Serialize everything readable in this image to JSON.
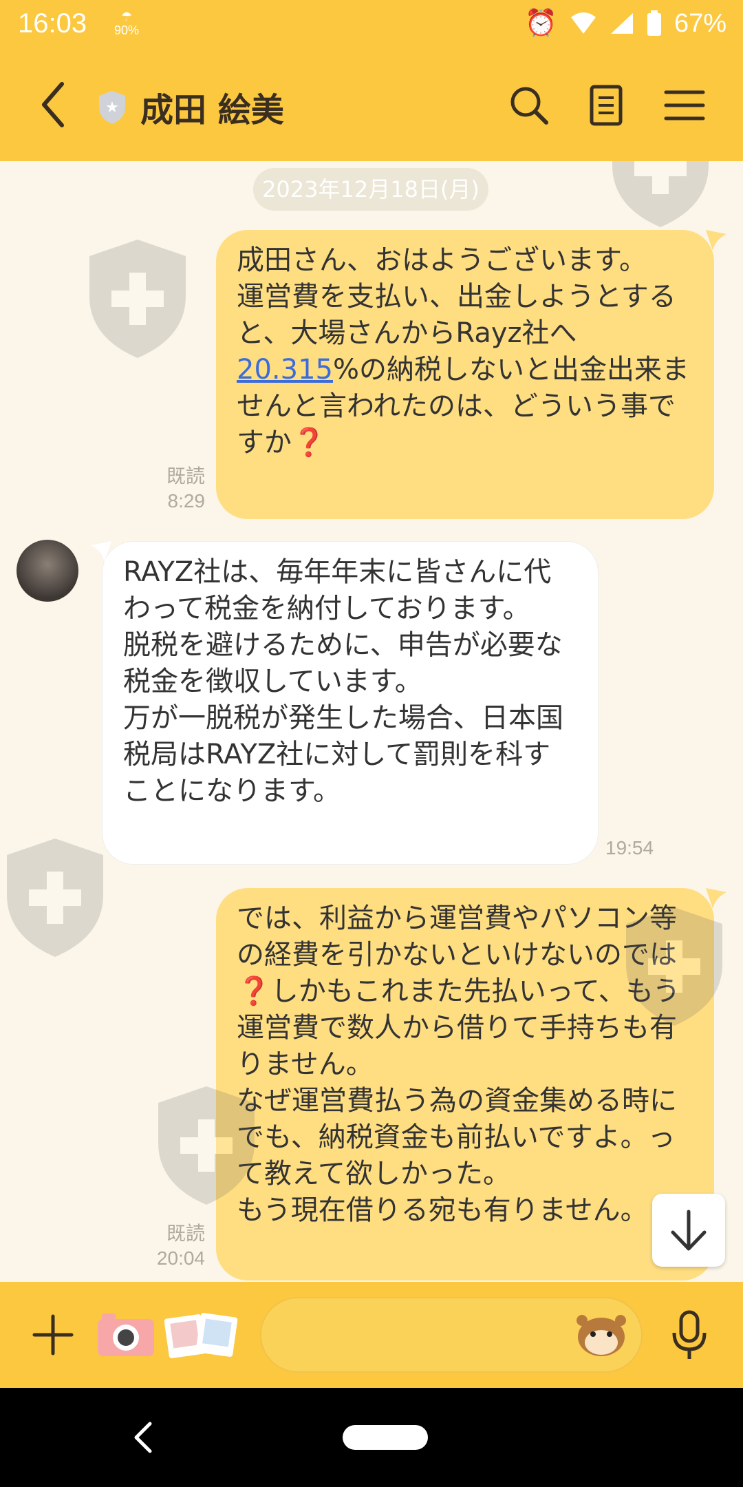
{
  "status_bar": {
    "time": "16:03",
    "data_saver": "90%",
    "battery": "67%",
    "icons": [
      "alarm-icon",
      "wifi-icon",
      "signal-icon",
      "battery-icon"
    ]
  },
  "header": {
    "contact_name": "成田 絵美",
    "icons": [
      "back-icon",
      "shield-badge-icon",
      "search-icon",
      "notes-icon",
      "menu-icon"
    ]
  },
  "chat": {
    "date_separator": "2023年12月18日(月)",
    "messages": [
      {
        "sender": "me",
        "text_before_link": "成田さん、おはようございます。\n運営費を支払い、出金しようとすると、大場さんからRayz社へ",
        "link": "20.315",
        "text_after_link": "%の納税しないと出金出来ませんと言われたのは、どういう事ですか❓",
        "read": "既読",
        "time": "8:29"
      },
      {
        "sender": "them",
        "text": "RAYZ社は、毎年年末に皆さんに代わって税金を納付しております。\n脱税を避けるために、申告が必要な税金を徴収しています。\n万が一脱税が発生した場合、日本国税局はRAYZ社に対して罰則を科すことになります。",
        "time": "19:54"
      },
      {
        "sender": "me",
        "text": "では、利益から運営費やパソコン等の経費を引かないといけないのでは❓しかもこれまた先払いって、もう運営費で数人から借りて手持ちも有りません。\nなぜ運営費払う為の資金集める時にでも、納税資金も前払いですよ。って教えて欲しかった。\nもう現在借りる宛も有りません。",
        "read": "既読",
        "time": "20:04"
      }
    ]
  },
  "composer": {
    "placeholder": "",
    "icons": [
      "plus-icon",
      "camera-icon",
      "photo-sticker-icon",
      "hamster-emoji-icon",
      "mic-icon"
    ]
  },
  "colors": {
    "header_bg": "#fbc83f",
    "chat_bg": "#fbf6e9",
    "my_bubble": "#ffde82",
    "their_bubble": "#ffffff",
    "link": "#3b6cd9"
  }
}
